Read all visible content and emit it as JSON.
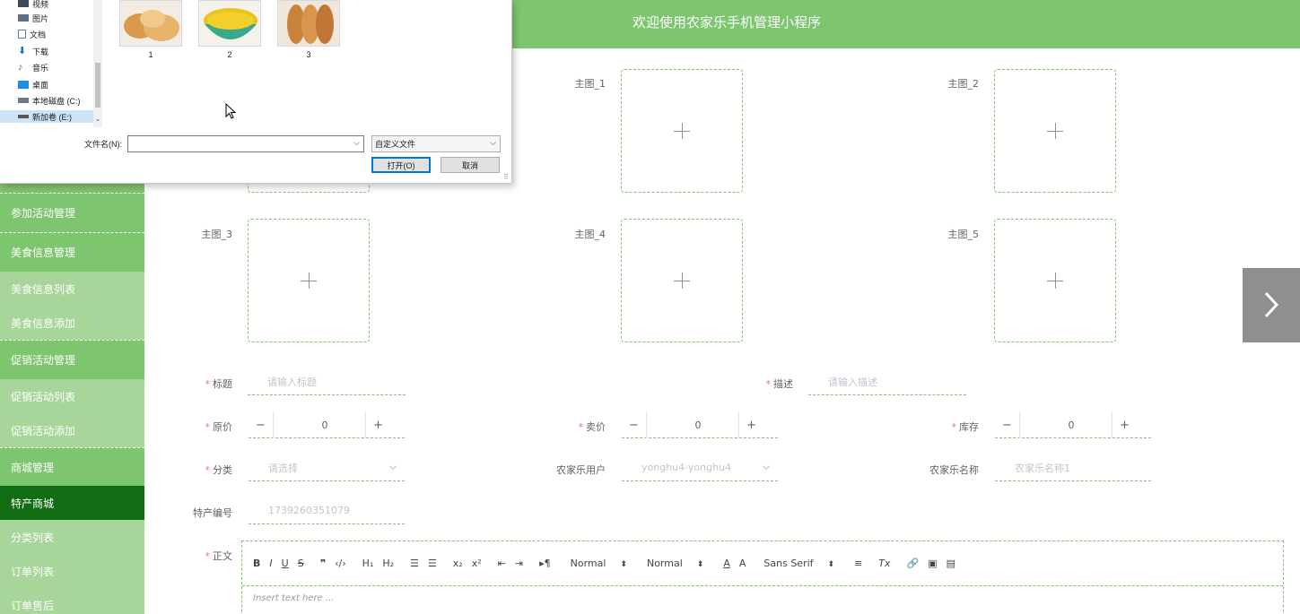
{
  "header": {
    "title": "欢迎使用农家乐手机管理小程序"
  },
  "sidebar": {
    "items": [
      {
        "label": "参加活动管理",
        "type": "parent",
        "top": 0
      },
      {
        "label": "美食信息管理",
        "type": "parent"
      },
      {
        "label": "美食信息列表",
        "type": "child"
      },
      {
        "label": "美食信息添加",
        "type": "child"
      },
      {
        "label": "促销活动管理",
        "type": "parent"
      },
      {
        "label": "促销活动列表",
        "type": "child"
      },
      {
        "label": "促销活动添加",
        "type": "child"
      },
      {
        "label": "商城管理",
        "type": "parent"
      },
      {
        "label": "特产商城",
        "type": "active"
      },
      {
        "label": "分类列表",
        "type": "child"
      },
      {
        "label": "订单列表",
        "type": "child"
      },
      {
        "label": "订单售后",
        "type": "child"
      }
    ]
  },
  "form": {
    "images": {
      "main1_label": "主图_1",
      "main2_label": "主图_2",
      "main3_label": "主图_3",
      "main4_label": "主图_4",
      "main5_label": "主图_5"
    },
    "title": {
      "label": "标题",
      "placeholder": "请输入标题"
    },
    "desc": {
      "label": "描述",
      "placeholder": "请输入描述"
    },
    "original_price": {
      "label": "原价",
      "value": "0"
    },
    "sale_price": {
      "label": "卖价",
      "value": "0"
    },
    "stock": {
      "label": "库存",
      "value": "0"
    },
    "category": {
      "label": "分类",
      "placeholder": "请选择"
    },
    "farm_user": {
      "label": "农家乐用户",
      "value": "yonghu4-yonghu4"
    },
    "farm_name": {
      "label": "农家乐名称",
      "value": "农家乐名称1"
    },
    "product_no": {
      "label": "特产编号",
      "value": "1739260351079"
    },
    "content": {
      "label": "正文",
      "placeholder": "Insert text here ..."
    },
    "required_mark": "*"
  },
  "editor_toolbar": {
    "bold": "B",
    "italic": "I",
    "underline": "U",
    "strike": "S",
    "quote": "❞",
    "code": "‹/›",
    "h1": "H₁",
    "h2": "H₂",
    "ordered": "☰",
    "bullet": "☰",
    "sub": "x₂",
    "sup": "x²",
    "outdent": "⇤",
    "indent": "⇥",
    "rtl": "▸¶",
    "size_select": "Normal",
    "header_select": "Normal",
    "color": "A",
    "background": "A",
    "font_select": "Sans Serif",
    "align": "≡",
    "clean": "Tx",
    "link": "🔗",
    "image": "▣",
    "video": "▤",
    "select_arrow": "⬍"
  },
  "file_dialog": {
    "nav_items": [
      "视频",
      "图片",
      "文档",
      "下载",
      "音乐",
      "桌面",
      "本地磁盘 (C:)",
      "新加卷 (E:)"
    ],
    "thumbnails": [
      "1",
      "2",
      "3"
    ],
    "filename_label": "文件名(N):",
    "filename_value": "",
    "filetype": "自定义文件",
    "open_button": "打开(O)",
    "cancel_button": "取消",
    "scroll_down": "⌄",
    "dropdown_arrow": "⌵"
  },
  "colors": {
    "primary": "#7ec56f",
    "active": "#116c13",
    "child": "#a7d59a",
    "required": "#f56c6c"
  },
  "icons": {
    "next": "chevron-right-icon",
    "upload": "plus-icon"
  }
}
